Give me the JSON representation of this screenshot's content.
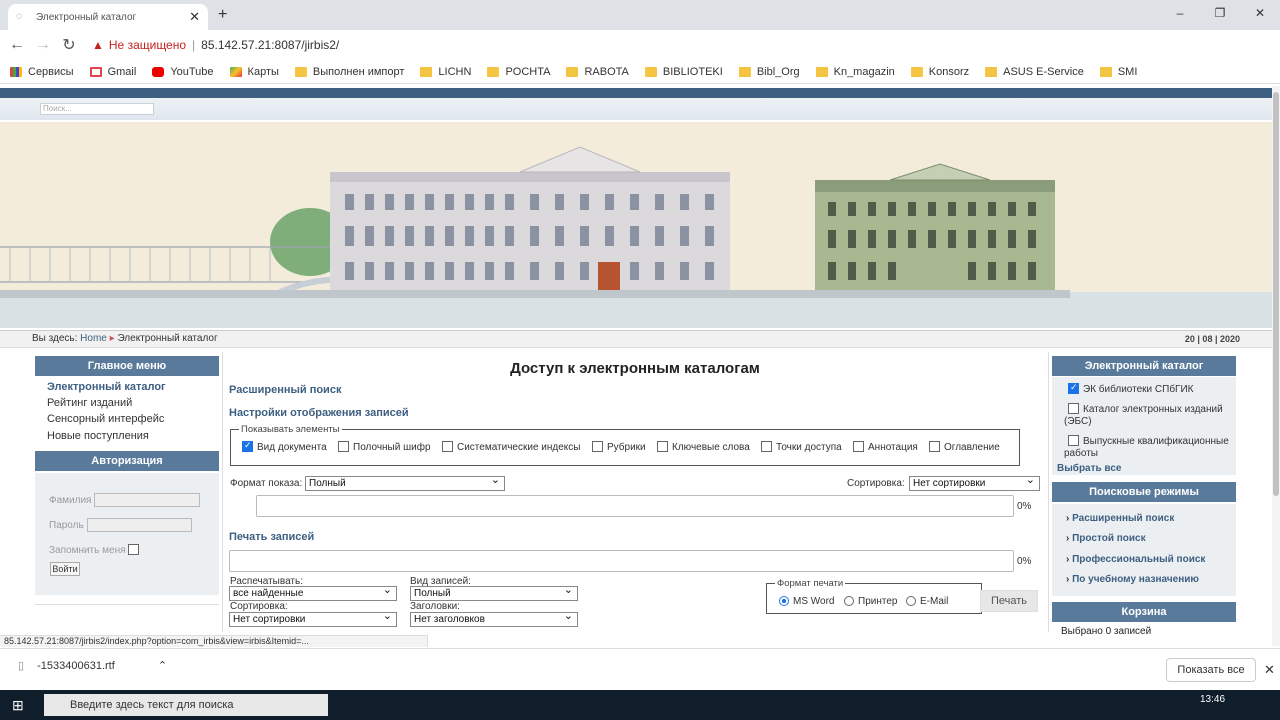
{
  "browser": {
    "tab_title": "Электронный каталог",
    "new_tab": "+",
    "window_controls": [
      "–",
      "❐",
      "✕"
    ],
    "security_label": "Не защищено",
    "url": "85.142.57.21:8087/jirbis2/",
    "status_url": "85.142.57.21:8087/jirbis2/index.php?option=com_irbis&view=irbis&Itemid=..."
  },
  "bookmarks": [
    {
      "label": "Сервисы",
      "icon": "apps-icon"
    },
    {
      "label": "Gmail",
      "icon": "gmail-icon"
    },
    {
      "label": "YouTube",
      "icon": "youtube-icon"
    },
    {
      "label": "Карты",
      "icon": "maps-icon"
    },
    {
      "label": "Выполнен импорт",
      "icon": "folder-icon"
    },
    {
      "label": "LICHN",
      "icon": "folder-icon"
    },
    {
      "label": "POCHTA",
      "icon": "folder-icon"
    },
    {
      "label": "RABOTA",
      "icon": "folder-icon"
    },
    {
      "label": "BIBLIOTEKI",
      "icon": "folder-icon"
    },
    {
      "label": "Bibl_Org",
      "icon": "folder-icon"
    },
    {
      "label": "Kn_magazin",
      "icon": "folder-icon"
    },
    {
      "label": "Konsorz",
      "icon": "folder-icon"
    },
    {
      "label": "ASUS E-Service",
      "icon": "folder-icon"
    },
    {
      "label": "SMI",
      "icon": "folder-icon"
    }
  ],
  "site": {
    "search_placeholder": "Поиск...",
    "breadcrumb_prefix": "Вы здесь:",
    "breadcrumb_home": "Home",
    "breadcrumb_current": "Электронный каталог",
    "date": "20 | 08 | 2020"
  },
  "left": {
    "main_menu_title": "Главное меню",
    "menu": [
      "Электронный каталог",
      "Рейтинг изданий",
      "Сенсорный интерфейс",
      "Новые поступления"
    ],
    "auth_title": "Авторизация",
    "surname_label": "Фамилия",
    "password_label": "Пароль",
    "remember_label": "Запомнить меня",
    "login_button": "Войти"
  },
  "center": {
    "title": "Доступ к электронным каталогам",
    "advanced_search": "Расширенный поиск",
    "display_settings": "Настройки отображения записей",
    "show_elements_legend": "Показывать элементы",
    "elements": [
      {
        "label": "Вид документа",
        "checked": true
      },
      {
        "label": "Полочный шифр",
        "checked": false
      },
      {
        "label": "Систематические индексы",
        "checked": false
      },
      {
        "label": "Рубрики",
        "checked": false
      },
      {
        "label": "Ключевые слова",
        "checked": false
      },
      {
        "label": "Точки доступа",
        "checked": false
      },
      {
        "label": "Аннотация",
        "checked": false
      },
      {
        "label": "Оглавление",
        "checked": false
      }
    ],
    "format_label": "Формат показа:",
    "format_value": "Полный",
    "sort_label": "Сортировка:",
    "sort_value": "Нет сортировки",
    "progress1": "0%",
    "print_title": "Печать записей",
    "progress2": "0%",
    "print_what_label": "Распечатывать:",
    "print_what_value": "все найденные",
    "records_view_label": "Вид записей:",
    "records_view_value": "Полный",
    "print_sort_label": "Сортировка:",
    "print_sort_value": "Нет сортировки",
    "headings_label": "Заголовки:",
    "headings_value": "Нет заголовков",
    "print_format_legend": "Формат печати",
    "print_formats": [
      {
        "label": "MS Word",
        "selected": true
      },
      {
        "label": "Принтер",
        "selected": false
      },
      {
        "label": "E-Mail",
        "selected": false
      }
    ],
    "print_button": "Печать"
  },
  "right": {
    "catalog_title": "Электронный каталог",
    "catalogs": [
      {
        "label": "ЭК библиотеки СПбГИК",
        "checked": true
      },
      {
        "label": "Каталог электронных изданий (ЭБС)",
        "checked": false
      },
      {
        "label": "Выпускные квалификационные работы",
        "checked": false
      }
    ],
    "select_all": "Выбрать все",
    "modes_title": "Поисковые режимы",
    "modes": [
      "Расширенный поиск",
      "Простой поиск",
      "Профессиональный поиск",
      "По учебному назначению"
    ],
    "basket_title": "Корзина",
    "basket_status": "Выбрано 0 записей"
  },
  "downloads": {
    "file": "-1533400631.rtf",
    "show_all": "Показать все"
  },
  "taskbar": {
    "search_placeholder": "Введите здесь текст для поиска",
    "time": "13:46"
  }
}
